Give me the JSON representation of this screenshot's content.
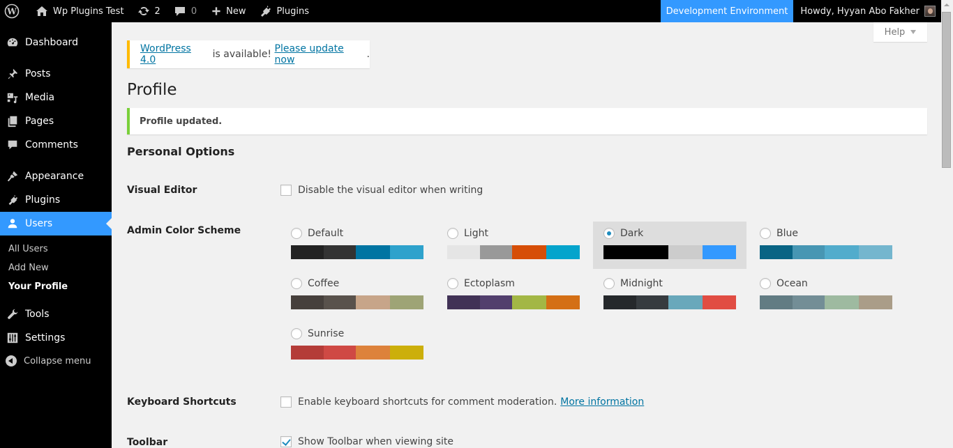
{
  "adminbar": {
    "site_name": "Wp Plugins Test",
    "updates_count": "2",
    "comments_count": "0",
    "new_label": "New",
    "plugins_label": "Plugins",
    "environment_label": "Development Environment",
    "howdy": "Howdy, Hyyan Abo Fakher",
    "env_color": "#3399ff"
  },
  "sidebar": {
    "items": [
      {
        "label": "Dashboard",
        "icon": "dashboard-icon"
      },
      {
        "label": "Posts",
        "icon": "pin-icon"
      },
      {
        "label": "Media",
        "icon": "media-icon"
      },
      {
        "label": "Pages",
        "icon": "pages-icon"
      },
      {
        "label": "Comments",
        "icon": "comment-icon"
      },
      {
        "label": "Appearance",
        "icon": "brush-icon"
      },
      {
        "label": "Plugins",
        "icon": "plugin-icon"
      },
      {
        "label": "Users",
        "icon": "user-icon",
        "active": true
      },
      {
        "label": "Tools",
        "icon": "wrench-icon"
      },
      {
        "label": "Settings",
        "icon": "settings-icon"
      }
    ],
    "submenu": [
      "All Users",
      "Add New",
      "Your Profile"
    ],
    "current_submenu": "Your Profile",
    "collapse_label": "Collapse menu"
  },
  "help": {
    "label": "Help"
  },
  "notices": {
    "update_link": "WordPress 4.0",
    "update_text": " is available! ",
    "update_now_link": "Please update now",
    "update_end": ".",
    "success": "Profile updated."
  },
  "page": {
    "title": "Profile",
    "section_title": "Personal Options"
  },
  "options": {
    "visual_editor": {
      "label": "Visual Editor",
      "text": "Disable the visual editor when writing",
      "checked": false
    },
    "color_scheme_label": "Admin Color Scheme",
    "schemes": [
      {
        "name": "Default",
        "selected": false,
        "colors": [
          "#222222",
          "#333333",
          "#0074a2",
          "#2ea2cc"
        ]
      },
      {
        "name": "Light",
        "selected": false,
        "colors": [
          "#e5e5e5",
          "#999999",
          "#d64e07",
          "#04a4cc"
        ]
      },
      {
        "name": "Dark",
        "selected": true,
        "colors": [
          "#000000",
          "#000000",
          "#cccccc",
          "#3399ff"
        ]
      },
      {
        "name": "Blue",
        "selected": false,
        "colors": [
          "#096484",
          "#4796b3",
          "#52accc",
          "#74b6ce"
        ]
      },
      {
        "name": "Coffee",
        "selected": false,
        "colors": [
          "#46403c",
          "#59524c",
          "#c7a589",
          "#9ea476"
        ]
      },
      {
        "name": "Ectoplasm",
        "selected": false,
        "colors": [
          "#413256",
          "#523f6d",
          "#a3b745",
          "#d46f15"
        ]
      },
      {
        "name": "Midnight",
        "selected": false,
        "colors": [
          "#25282b",
          "#363b3f",
          "#69a8bb",
          "#e14d43"
        ]
      },
      {
        "name": "Ocean",
        "selected": false,
        "colors": [
          "#627c83",
          "#738e96",
          "#9ebaa0",
          "#aa9d88"
        ]
      },
      {
        "name": "Sunrise",
        "selected": false,
        "colors": [
          "#b43c38",
          "#cf4944",
          "#dd823b",
          "#ccaf0b"
        ]
      }
    ],
    "keyboard_shortcuts": {
      "label": "Keyboard Shortcuts",
      "text": "Enable keyboard shortcuts for comment moderation.",
      "link": "More information",
      "checked": false
    },
    "toolbar": {
      "label": "Toolbar",
      "text": "Show Toolbar when viewing site",
      "checked": true
    }
  }
}
